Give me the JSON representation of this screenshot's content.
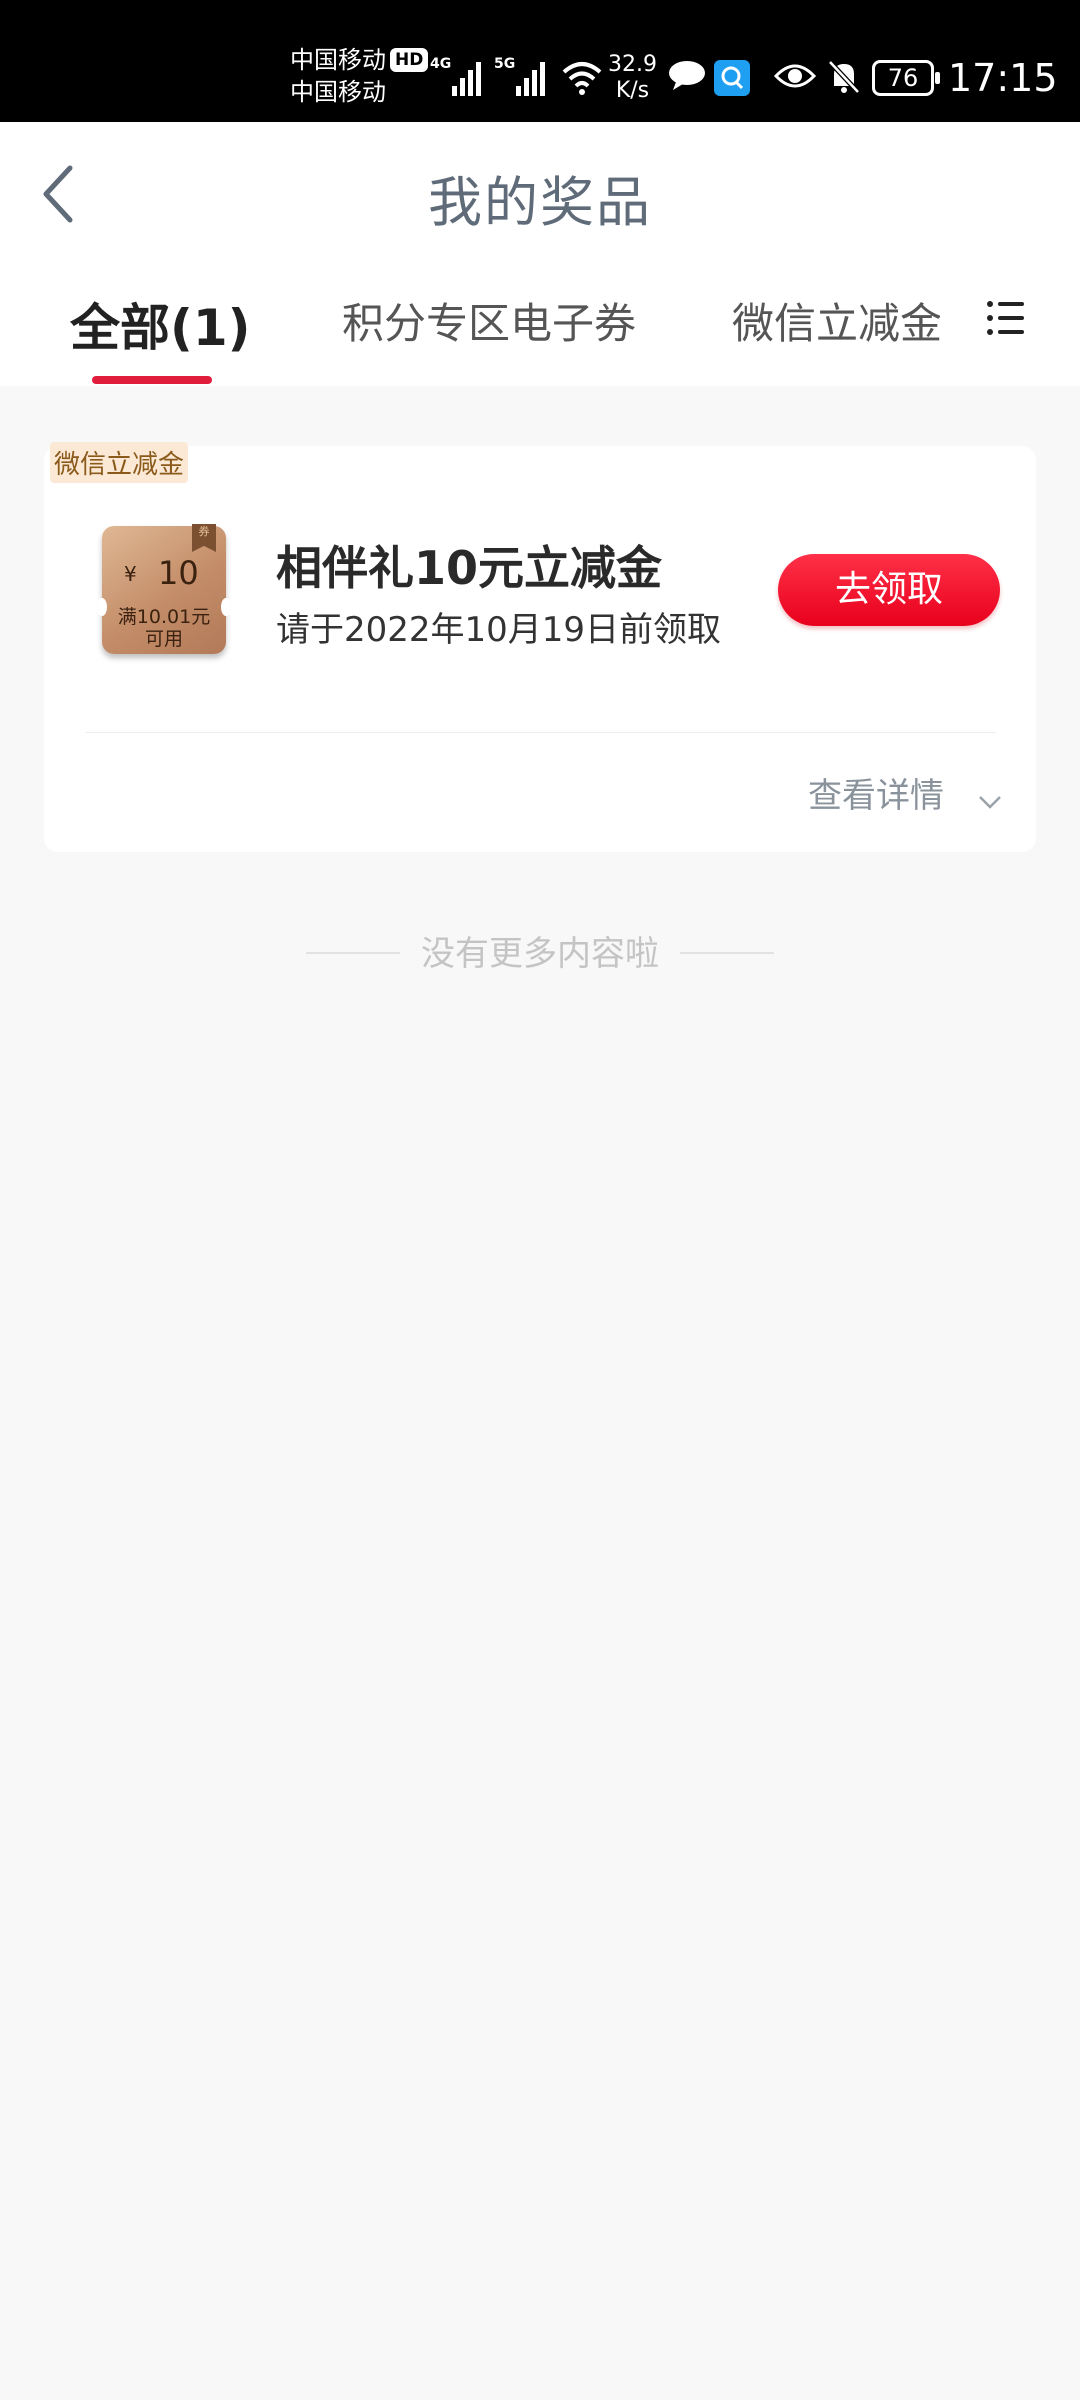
{
  "status_bar": {
    "carrier1": "中国移动",
    "hd_badge": "HD",
    "carrier2": "中国移动",
    "net1": "4G",
    "net2": "5G",
    "speed_value": "32.9",
    "speed_unit": "K/s",
    "battery": "76",
    "time": "17:15"
  },
  "header": {
    "title": "我的奖品"
  },
  "tabs": [
    {
      "label": "全部(1)",
      "active": true
    },
    {
      "label": "积分专区电子券",
      "active": false
    },
    {
      "label": "微信立减金(",
      "active": false
    }
  ],
  "prize_card": {
    "tag": "微信立减金",
    "coupon": {
      "flag": "券",
      "currency": "¥",
      "amount": "10",
      "condition_line1": "满10.01元",
      "condition_line2": "可用"
    },
    "title": "相伴礼10元立减金",
    "deadline": "请于2022年10月19日前领取",
    "claim_button": "去领取",
    "detail_link": "查看详情"
  },
  "footer": {
    "no_more": "没有更多内容啦"
  },
  "colors": {
    "accent_red": "#e01e3c",
    "button_red": "#ff1f3a",
    "title_gray": "#5f6b78"
  }
}
